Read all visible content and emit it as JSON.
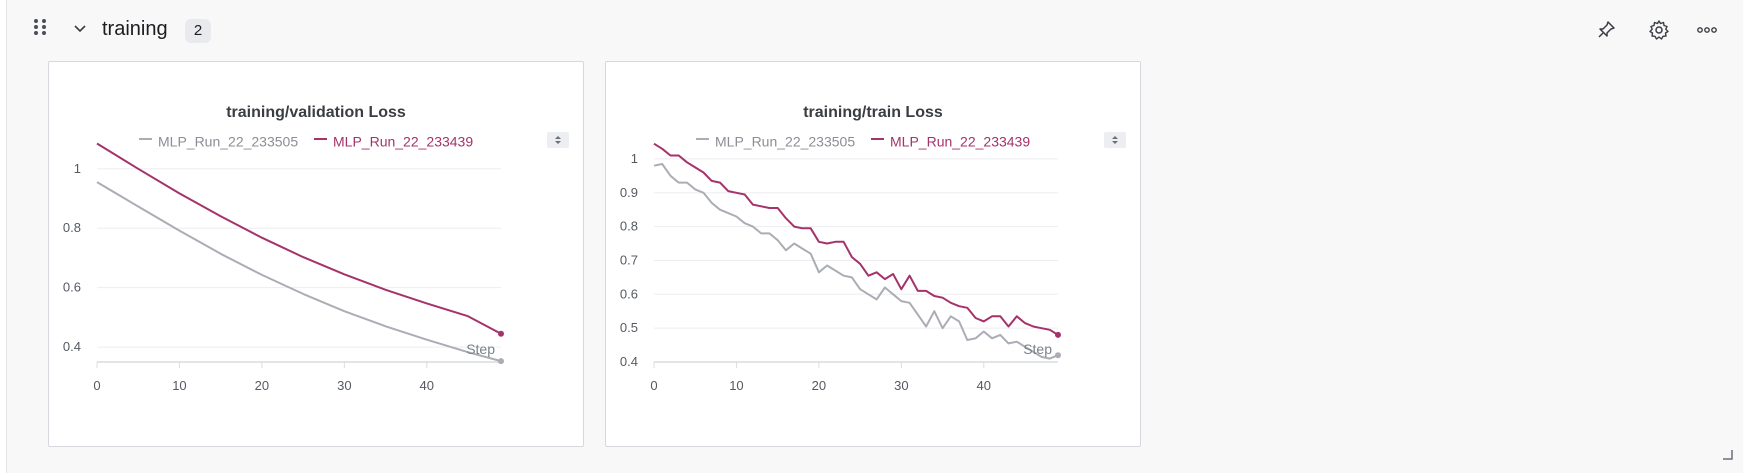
{
  "section": {
    "title": "training",
    "count": "2"
  },
  "header_icons": [
    "pin-icon",
    "gear-icon",
    "more-icon"
  ],
  "colors": {
    "gray": "#aaaeb4",
    "magenta": "#a5326b",
    "grid": "#ededf0",
    "axis": "#dadce0"
  },
  "panels": [
    {
      "title": "training/validation Loss",
      "legend": [
        {
          "name": "MLP_Run_22_233505",
          "color": "#aaaeb4"
        },
        {
          "name": "MLP_Run_22_233439",
          "color": "#a5326b"
        }
      ],
      "x_label": "Step"
    },
    {
      "title": "training/train Loss",
      "legend": [
        {
          "name": "MLP_Run_22_233505",
          "color": "#aaaeb4"
        },
        {
          "name": "MLP_Run_22_233439",
          "color": "#a5326b"
        }
      ],
      "x_label": "Step"
    }
  ],
  "chart_data": [
    {
      "type": "line",
      "title": "training/validation Loss",
      "xlabel": "Step",
      "ylabel": "",
      "xlim": [
        0,
        49
      ],
      "ylim": [
        0.35,
        1.09
      ],
      "xticks": [
        0,
        10,
        20,
        30,
        40
      ],
      "yticks": [
        1,
        0.8,
        0.6,
        0.4
      ],
      "yticklabels": [
        "1",
        "0.8",
        "0.6",
        "0.4"
      ],
      "grid": true,
      "legend_position": "top",
      "series": [
        {
          "name": "MLP_Run_22_233505",
          "color": "#aaaeb4",
          "x": [
            0,
            5,
            10,
            15,
            20,
            25,
            30,
            35,
            40,
            45,
            49
          ],
          "y": [
            0.955,
            0.873,
            0.792,
            0.714,
            0.643,
            0.579,
            0.521,
            0.47,
            0.425,
            0.383,
            0.353
          ]
        },
        {
          "name": "MLP_Run_22_233439",
          "color": "#a5326b",
          "x": [
            0,
            5,
            10,
            15,
            20,
            25,
            30,
            35,
            40,
            45,
            49
          ],
          "y": [
            1.085,
            1.0,
            0.917,
            0.84,
            0.768,
            0.703,
            0.645,
            0.593,
            0.547,
            0.504,
            0.445
          ]
        }
      ]
    },
    {
      "type": "line",
      "title": "training/train Loss",
      "xlabel": "Step",
      "ylabel": "",
      "xlim": [
        0,
        49
      ],
      "ylim": [
        0.4,
        1.05
      ],
      "xticks": [
        0,
        10,
        20,
        30,
        40
      ],
      "yticks": [
        1,
        0.9,
        0.8,
        0.7,
        0.6,
        0.5,
        0.4
      ],
      "yticklabels": [
        "1",
        "0.9",
        "0.8",
        "0.7",
        "0.6",
        "0.5",
        "0.4"
      ],
      "grid": true,
      "legend_position": "top",
      "series": [
        {
          "name": "MLP_Run_22_233505",
          "color": "#aaaeb4",
          "x": [
            0,
            1,
            2,
            3,
            4,
            5,
            6,
            7,
            8,
            9,
            10,
            11,
            12,
            13,
            14,
            15,
            16,
            17,
            18,
            19,
            20,
            21,
            22,
            23,
            24,
            25,
            26,
            27,
            28,
            29,
            30,
            31,
            32,
            33,
            34,
            35,
            36,
            37,
            38,
            39,
            40,
            41,
            42,
            43,
            44,
            45,
            46,
            47,
            48,
            49
          ],
          "y": [
            0.98,
            0.985,
            0.95,
            0.93,
            0.93,
            0.91,
            0.9,
            0.87,
            0.85,
            0.84,
            0.83,
            0.81,
            0.8,
            0.78,
            0.78,
            0.76,
            0.73,
            0.75,
            0.735,
            0.72,
            0.665,
            0.685,
            0.67,
            0.655,
            0.65,
            0.615,
            0.6,
            0.585,
            0.62,
            0.6,
            0.58,
            0.575,
            0.54,
            0.505,
            0.55,
            0.5,
            0.535,
            0.52,
            0.465,
            0.47,
            0.49,
            0.47,
            0.48,
            0.455,
            0.46,
            0.445,
            0.43,
            0.415,
            0.41,
            0.42
          ]
        },
        {
          "name": "MLP_Run_22_233439",
          "color": "#a5326b",
          "x": [
            0,
            1,
            2,
            3,
            4,
            5,
            6,
            7,
            8,
            9,
            10,
            11,
            12,
            13,
            14,
            15,
            16,
            17,
            18,
            19,
            20,
            21,
            22,
            23,
            24,
            25,
            26,
            27,
            28,
            29,
            30,
            31,
            32,
            33,
            34,
            35,
            36,
            37,
            38,
            39,
            40,
            41,
            42,
            43,
            44,
            45,
            46,
            47,
            48,
            49
          ],
          "y": [
            1.045,
            1.03,
            1.01,
            1.01,
            0.99,
            0.975,
            0.96,
            0.935,
            0.93,
            0.905,
            0.9,
            0.895,
            0.865,
            0.86,
            0.855,
            0.855,
            0.825,
            0.8,
            0.795,
            0.795,
            0.755,
            0.75,
            0.755,
            0.755,
            0.71,
            0.69,
            0.655,
            0.665,
            0.645,
            0.66,
            0.615,
            0.655,
            0.61,
            0.61,
            0.595,
            0.59,
            0.575,
            0.565,
            0.56,
            0.53,
            0.52,
            0.535,
            0.535,
            0.505,
            0.535,
            0.515,
            0.505,
            0.5,
            0.495,
            0.48
          ]
        }
      ]
    }
  ]
}
